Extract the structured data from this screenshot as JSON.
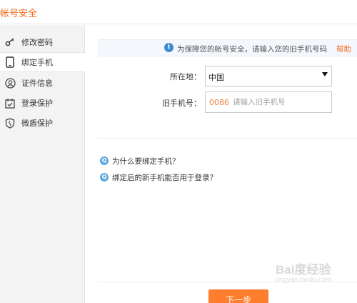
{
  "header": {
    "title": "帐号安全"
  },
  "sidebar": {
    "items": [
      {
        "label": "修改密码",
        "icon": "key-icon"
      },
      {
        "label": "绑定手机",
        "icon": "phone-icon",
        "active": true
      },
      {
        "label": "证件信息",
        "icon": "user-id-icon"
      },
      {
        "label": "登录保护",
        "icon": "login-protect-icon"
      },
      {
        "label": "微盾保护",
        "icon": "shield-icon"
      }
    ]
  },
  "main": {
    "notice": {
      "text": "为保障您的帐号安全，请输入您的旧手机号码",
      "help": "帮助",
      "icon": "i"
    },
    "form": {
      "location_label": "所在地：",
      "location_value": "中国",
      "phone_label": "旧手机号：",
      "phone_prefix": "0086",
      "phone_placeholder": "请输入旧手机号",
      "phone_value": ""
    },
    "faq": [
      {
        "icon": "Q",
        "text": "为什么要绑定手机？"
      },
      {
        "icon": "Q",
        "text": "绑定后的新手机能否用于登录？"
      }
    ],
    "next_button": "下一步"
  },
  "watermark": {
    "logo": "Bai度经验",
    "url": "jingyan.baidu.com"
  },
  "colors": {
    "accent": "#f26b1d",
    "button": "#ff7e2e",
    "info": "#3d8ad6"
  }
}
